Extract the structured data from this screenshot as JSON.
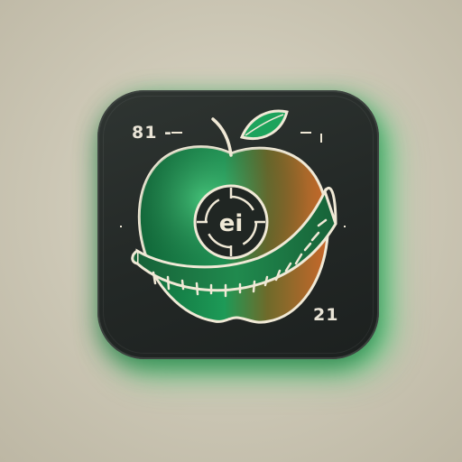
{
  "icon": {
    "top_left_label": "81 -",
    "bottom_right_label": "21",
    "center_label": "ei",
    "name": "apple-tape-measure-icon"
  },
  "colors": {
    "background": "#cfcab8",
    "tile": "#242a27",
    "glow": "#28dc6e",
    "apple_green": "#1f9e5a",
    "apple_orange": "#d9742a",
    "tape_green": "#1f7a46",
    "outline": "#efe8d6"
  }
}
